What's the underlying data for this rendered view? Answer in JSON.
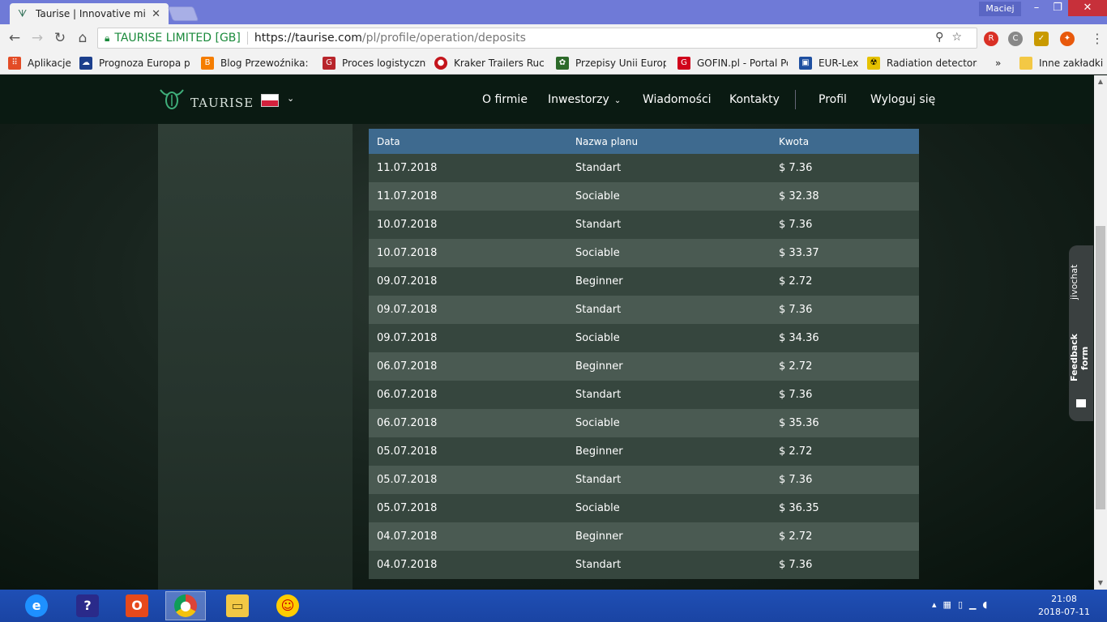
{
  "browser": {
    "tab_title": "Taurise | Innovative mining",
    "user_name": "Maciej",
    "win_min": "–",
    "win_max": "❐",
    "win_close": "✕",
    "omnibox": {
      "org_label": "TAURISE LIMITED [GB]",
      "url_host": "https://taurise.com",
      "url_path": "/pl/profile/operation/deposits"
    },
    "bookmarks": [
      {
        "label": "Aplikacje",
        "icon": "apps-grid-icon",
        "color": "#e34c26"
      },
      {
        "label": "Prognoza Europa po",
        "icon": "weather-icon",
        "color": "#1c3f8c"
      },
      {
        "label": "Blog Przewoźnika: C",
        "icon": "blogger-icon",
        "color": "#f57d00"
      },
      {
        "label": "Proces logistyczny",
        "icon": "g-icon",
        "color": "#b8252b"
      },
      {
        "label": "Kraker Trailers Ruch",
        "icon": "kraker-icon",
        "color": "#c4151c"
      },
      {
        "label": "Przepisy Unii Europe",
        "icon": "eu-icon",
        "color": "#2d6a2a"
      },
      {
        "label": "GOFIN.pl - Portal Po",
        "icon": "gofin-icon",
        "color": "#d0021b"
      },
      {
        "label": "EUR-Lex",
        "icon": "eurlex-icon",
        "color": "#1e4fa0"
      },
      {
        "label": "Radiation detectors",
        "icon": "radiation-icon",
        "color": "#e6c200"
      }
    ],
    "bookmarks_more": "»",
    "other_bookmarks": "Inne zakładki"
  },
  "site": {
    "logo_text": "TAURISE",
    "menu": {
      "firm": "O firmie",
      "investors": "Inwestorzy",
      "news": "Wiadomości",
      "contacts": "Kontakty",
      "profile": "Profil",
      "logout": "Wyloguj się"
    },
    "deposits": {
      "headers": [
        "Data",
        "Nazwa planu",
        "Kwota"
      ],
      "rows": [
        [
          "11.07.2018",
          "Standart",
          "$ 7.36"
        ],
        [
          "11.07.2018",
          "Sociable",
          "$ 32.38"
        ],
        [
          "10.07.2018",
          "Standart",
          "$ 7.36"
        ],
        [
          "10.07.2018",
          "Sociable",
          "$ 33.37"
        ],
        [
          "09.07.2018",
          "Beginner",
          "$ 2.72"
        ],
        [
          "09.07.2018",
          "Standart",
          "$ 7.36"
        ],
        [
          "09.07.2018",
          "Sociable",
          "$ 34.36"
        ],
        [
          "06.07.2018",
          "Beginner",
          "$ 2.72"
        ],
        [
          "06.07.2018",
          "Standart",
          "$ 7.36"
        ],
        [
          "06.07.2018",
          "Sociable",
          "$ 35.36"
        ],
        [
          "05.07.2018",
          "Beginner",
          "$ 2.72"
        ],
        [
          "05.07.2018",
          "Standart",
          "$ 7.36"
        ],
        [
          "05.07.2018",
          "Sociable",
          "$ 36.35"
        ],
        [
          "04.07.2018",
          "Beginner",
          "$ 2.72"
        ],
        [
          "04.07.2018",
          "Standart",
          "$ 7.36"
        ]
      ]
    },
    "widgets": {
      "jivochat": "jivochat",
      "feedback": "Feedback form"
    }
  },
  "taskbar": {
    "time": "21:08",
    "date": "2018-07-11"
  }
}
